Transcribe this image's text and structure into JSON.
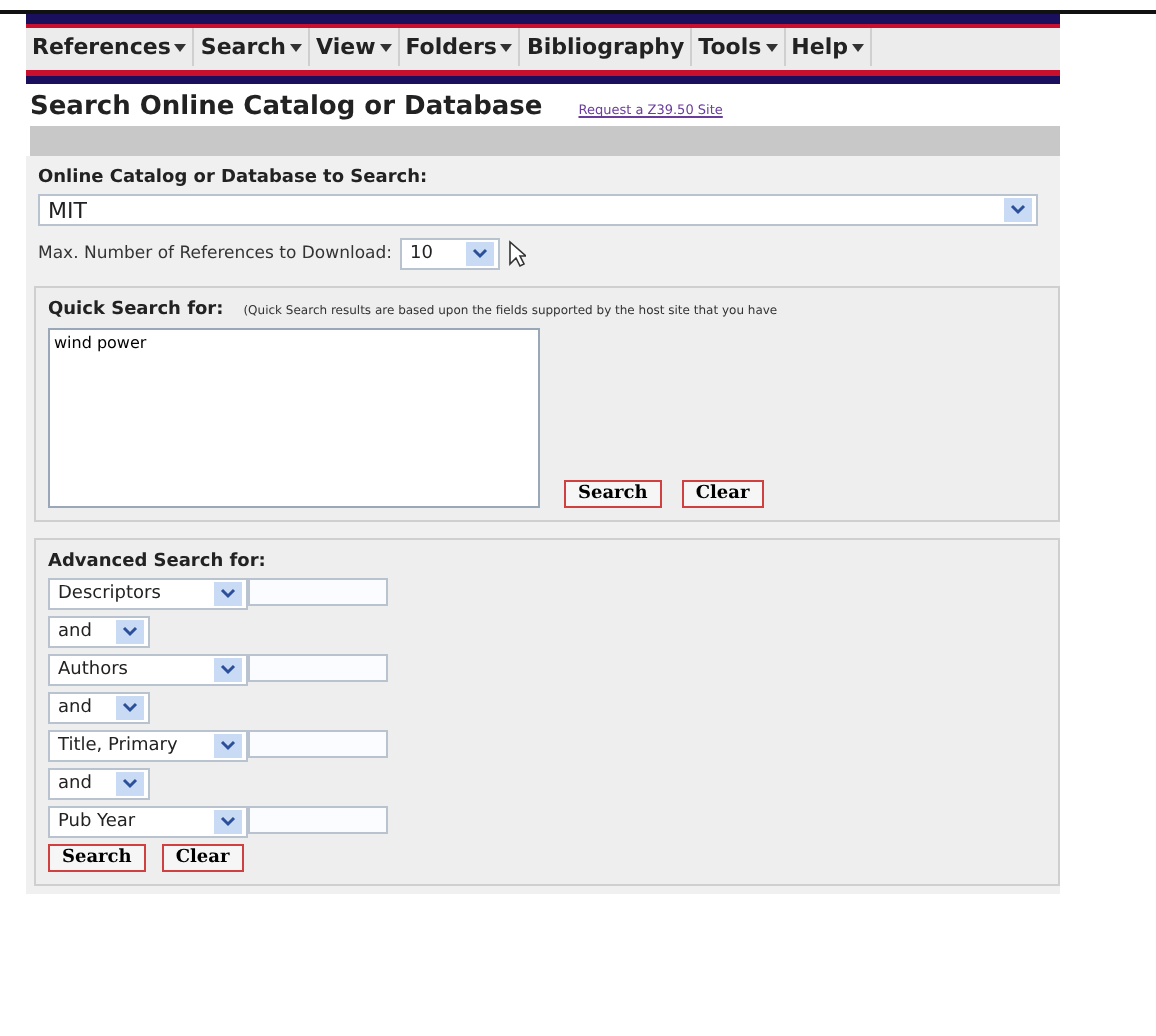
{
  "menu": [
    {
      "label": "References",
      "has_menu": true
    },
    {
      "label": "Search",
      "has_menu": true
    },
    {
      "label": "View",
      "has_menu": true
    },
    {
      "label": "Folders",
      "has_menu": true
    },
    {
      "label": "Bibliography",
      "has_menu": false
    },
    {
      "label": "Tools",
      "has_menu": true
    },
    {
      "label": "Help",
      "has_menu": true
    }
  ],
  "page_title": "Search Online Catalog or Database",
  "request_link": "Request a Z39.50 Site",
  "catalog": {
    "label": "Online Catalog or Database to Search:",
    "value": "MIT"
  },
  "max_refs": {
    "label": "Max. Number of References to Download:",
    "value": "10"
  },
  "quick_search": {
    "label": "Quick Search for:",
    "note": "(Quick Search results are based upon the fields supported by the host site that you have",
    "value": "wind power",
    "buttons": [
      "Search",
      "Clear"
    ]
  },
  "advanced_search": {
    "label": "Advanced Search for:",
    "rows": [
      {
        "kind": "field",
        "value": "Descriptors"
      },
      {
        "kind": "operator",
        "value": "and"
      },
      {
        "kind": "field",
        "value": "Authors"
      },
      {
        "kind": "operator",
        "value": "and"
      },
      {
        "kind": "field",
        "value": "Title, Primary"
      },
      {
        "kind": "operator",
        "value": "and"
      },
      {
        "kind": "field",
        "value": "Pub Year"
      }
    ],
    "buttons": [
      "Search",
      "Clear"
    ]
  }
}
